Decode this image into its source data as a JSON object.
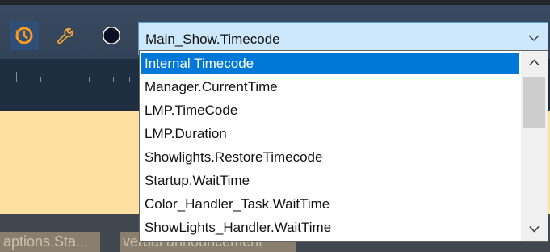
{
  "colors": {
    "selection": "#0078d7",
    "combo_background": "#cde7fb",
    "timeline_background": "#fddf9f",
    "toolbar": "#344559"
  },
  "toolbar": {
    "clock_icon": "history-clock-icon",
    "wrench_icon": "wrench-icon",
    "circle_icon": "dark-circle-icon",
    "timecode_source": {
      "value": "Main_Show.Timecode",
      "chevron_icon": "chevron-down-icon"
    }
  },
  "dropdown": {
    "items": [
      {
        "label": "Internal Timecode",
        "selected": true
      },
      {
        "label": "Manager.CurrentTime"
      },
      {
        "label": "LMP.TimeCode"
      },
      {
        "label": "LMP.Duration"
      },
      {
        "label": "Showlights.RestoreTimecode"
      },
      {
        "label": "Startup.WaitTime"
      },
      {
        "label": "Color_Handler_Task.WaitTime"
      },
      {
        "label": "ShowLights_Handler.WaitTime"
      }
    ],
    "scroll_up_icon": "chevron-up-icon",
    "scroll_down_icon": "chevron-down-icon"
  },
  "timeline": {
    "clips": [
      {
        "label": "aptions.Sta..."
      },
      {
        "label": "verbal announcement"
      }
    ]
  }
}
